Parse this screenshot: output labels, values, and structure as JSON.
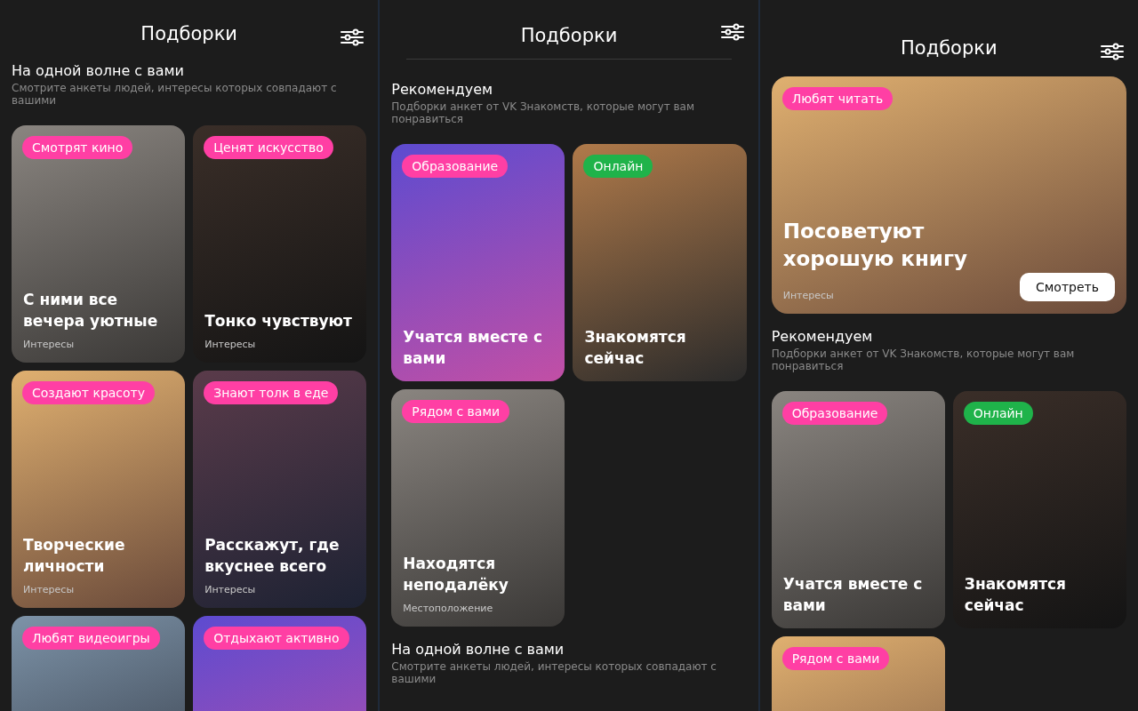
{
  "panels": [
    {
      "title": "Подборки",
      "blocks": [
        {
          "kind": "heading",
          "title": "На одной волне с вами",
          "subtitle": "Смотрите анкеты людей, интересы которых совпадают с вашими"
        },
        {
          "kind": "grid",
          "cards": [
            {
              "tag": "Смотрят кино",
              "color": "#ff3fa4",
              "title": "С ними все вечера уютные",
              "caption": "Интересы"
            },
            {
              "tag": "Ценят искусство",
              "color": "#ff3fa4",
              "title": "Тонко чувствуют",
              "caption": "Интересы"
            },
            {
              "tag": "Создают красоту",
              "color": "#ff3fa4",
              "title": "Творческие личности",
              "caption": "Интересы"
            },
            {
              "tag": "Знают толк в еде",
              "color": "#ff3fa4",
              "title": "Расскажут, где вкуснее всего",
              "caption": "Интересы"
            },
            {
              "tag": "Любят видеоигры",
              "color": "#ff3fa4"
            },
            {
              "tag": "Отдыхают активно",
              "color": "#ff3fa4"
            }
          ]
        }
      ]
    },
    {
      "title": "Подборки",
      "divider": true,
      "blocks": [
        {
          "kind": "heading",
          "title": "Рекомендуем",
          "subtitle": "Подборки анкет от VK Знакомств, которые могут вам понравиться"
        },
        {
          "kind": "grid",
          "cards": [
            {
              "tag": "Образование",
              "color": "#ff3fa4",
              "title": "Учатся вместе с вами"
            },
            {
              "tag": "Онлайн",
              "color": "#1fb34a",
              "title": "Знакомятся сейчас"
            },
            {
              "tag": "Рядом с вами",
              "color": "#ff3fa4",
              "title": "Находятся неподалёку",
              "caption": "Местоположение"
            }
          ]
        },
        {
          "kind": "heading",
          "title": "На одной волне с вами",
          "subtitle": "Смотрите анкеты людей, интересы которых совпадают с вашими"
        }
      ]
    },
    {
      "title": "Подборки",
      "blocks": [
        {
          "kind": "banner",
          "tag": "Любят читать",
          "color": "#ff3fa4",
          "title": "Посоветуют хорошую книгу",
          "caption": "Интересы",
          "button": "Смотреть"
        },
        {
          "kind": "heading",
          "title": "Рекомендуем",
          "subtitle": "Подборки анкет от VK Знакомств, которые могут вам понравиться"
        },
        {
          "kind": "grid",
          "cards": [
            {
              "tag": "Образование",
              "color": "#ff3fa4",
              "title": "Учатся вместе с вами"
            },
            {
              "tag": "Онлайн",
              "color": "#1fb34a",
              "title": "Знакомятся сейчас"
            },
            {
              "tag": "Рядом с вами",
              "color": "#ff3fa4"
            }
          ]
        }
      ]
    }
  ]
}
